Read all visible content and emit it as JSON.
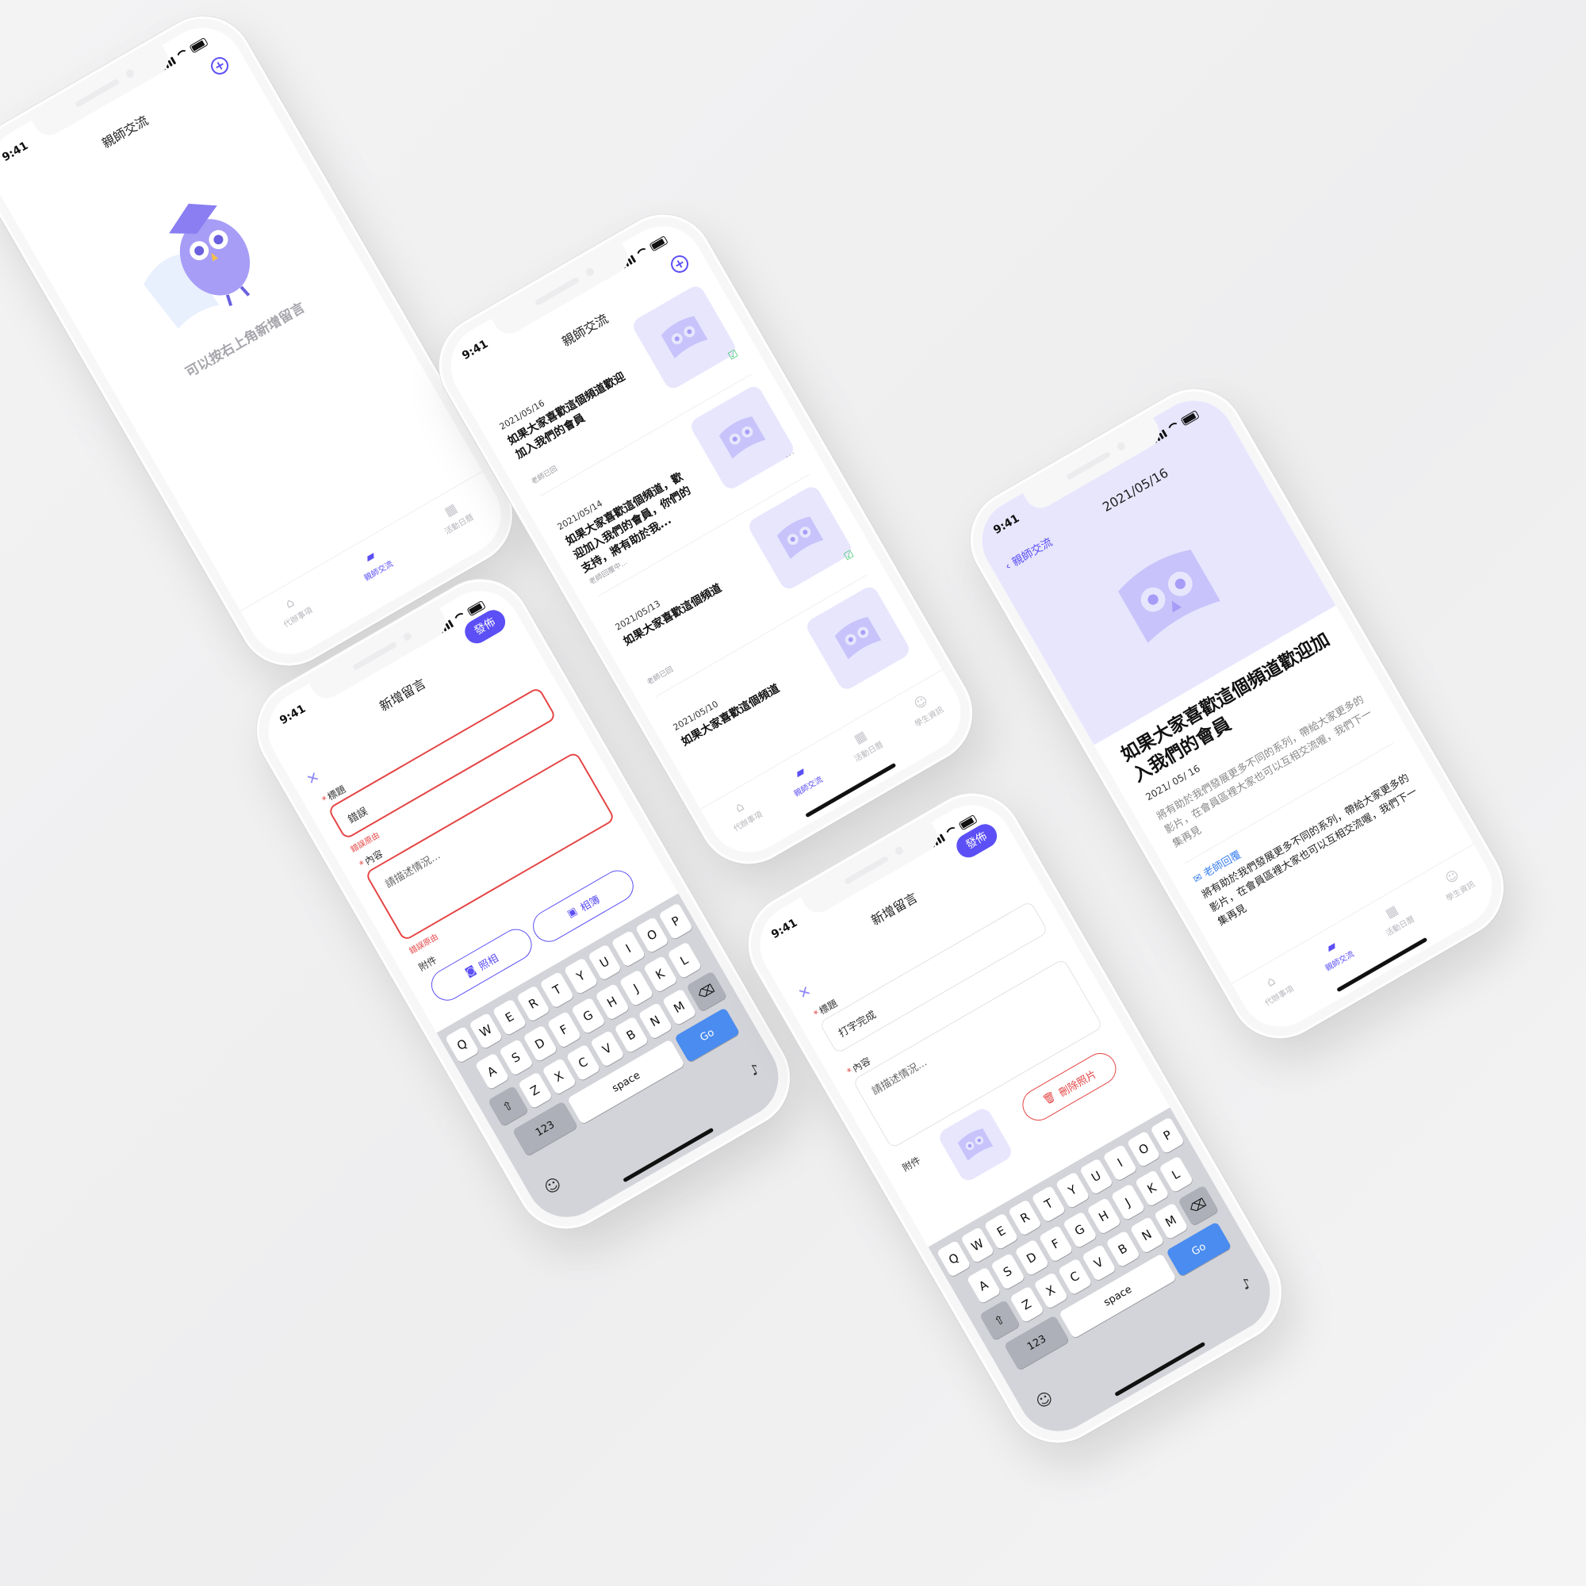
{
  "status_time": "9:41",
  "app": {
    "title_exchange": "親師交流",
    "title_new": "新增留言",
    "post_label": "發佈"
  },
  "tabs": [
    {
      "label": "代辦事項",
      "icon": "home-icon"
    },
    {
      "label": "親師交流",
      "icon": "chat-icon"
    },
    {
      "label": "活動日曆",
      "icon": "calendar-icon"
    },
    {
      "label": "學生資訊",
      "icon": "smile-icon"
    }
  ],
  "empty": {
    "hint": "可以按右上角新增留言"
  },
  "list": [
    {
      "date": "2021/05/16",
      "title": "如果大家喜歡這個頻道歡迎加入我們的會員",
      "status": "老師已回",
      "mark": "check"
    },
    {
      "date": "2021/05/14",
      "title": "如果大家喜歡這個頻道，歡迎加入我們的會員，你們的支持，將有助於我...",
      "status": "老師回覆中...",
      "mark": "dots"
    },
    {
      "date": "2021/05/13",
      "title": "如果大家喜歡這個頻道",
      "status": "老師已回",
      "mark": "check"
    },
    {
      "date": "2021/05/10",
      "title": "如果大家喜歡這個頻道",
      "status": "",
      "mark": ""
    }
  ],
  "form_error": {
    "title_label": "標題",
    "title_value": "錯誤",
    "error_reason": "錯誤原由",
    "content_label": "內容",
    "content_placeholder": "請描述情況...",
    "attach_label": "附件",
    "camera_label": "照相",
    "album_label": "相簿"
  },
  "form_done": {
    "title_label": "標題",
    "title_value": "打字完成",
    "content_label": "內容",
    "content_placeholder": "請描述情況...",
    "attach_label": "附件",
    "delete_label": "刪除照片"
  },
  "keyboard": {
    "row1": [
      "Q",
      "W",
      "E",
      "R",
      "T",
      "Y",
      "U",
      "I",
      "O",
      "P"
    ],
    "row2": [
      "A",
      "S",
      "D",
      "F",
      "G",
      "H",
      "J",
      "K",
      "L"
    ],
    "row3": [
      "Z",
      "X",
      "C",
      "V",
      "B",
      "N",
      "M"
    ],
    "numbers": "123",
    "space": "space",
    "go": "Go"
  },
  "detail": {
    "back_label": "親師交流",
    "nav_date": "2021/05/16",
    "title": "如果大家喜歡這個頻道歡迎加入我們的會員",
    "date": "2021/ 05/ 16",
    "body": "將有助於我們發展更多不同的系列，帶給大家更多的影片，在會員區裡大家也可以互相交流喔，我們下一集再見",
    "reply_label": "老師回覆",
    "reply_body": "將有助於我們發展更多不同的系列，帶給大家更多的影片，在會員區裡大家也可以互相交流喔，我們下一集再見"
  },
  "colors": {
    "accent": "#5b4ff5",
    "error": "#e54545",
    "success": "#39c46a",
    "tile": "#e7e6fd",
    "go": "#4a8cf0"
  }
}
